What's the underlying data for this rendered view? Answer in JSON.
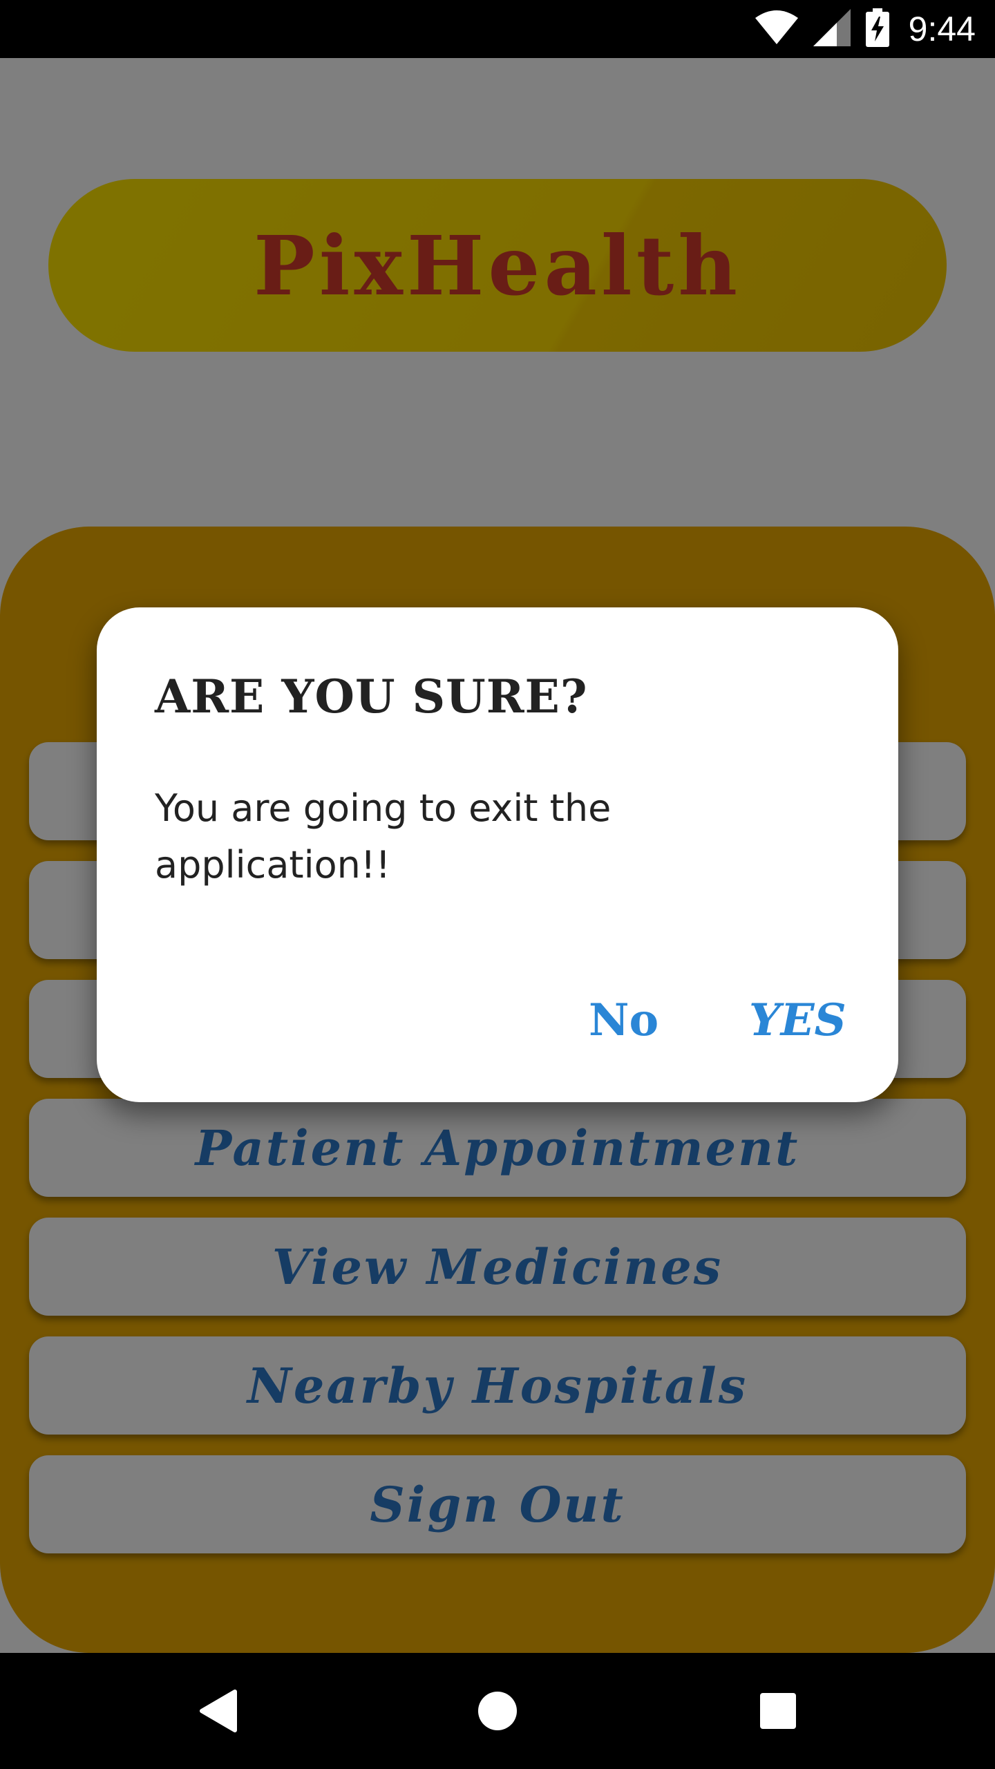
{
  "status_bar": {
    "time": "9:44",
    "icons": [
      "wifi-icon",
      "cell-signal-icon",
      "battery-charging-icon"
    ]
  },
  "app": {
    "title": "PixHealth",
    "menu_items": [
      "",
      "",
      "",
      "Patient Appointment",
      "View Medicines",
      "Nearby Hospitals",
      "Sign Out"
    ],
    "colors": {
      "title_bg": "#ffe600",
      "title_text": "#d33a2c",
      "panel_bg": "#ecab00",
      "menu_text": "#2c78c8"
    }
  },
  "dialog": {
    "title": "ARE YOU SURE?",
    "message": "You are going to exit the application!!",
    "no_label": "No",
    "yes_label": "YES",
    "button_color": "#2a86d6"
  },
  "nav_bar": {
    "icons": [
      "back-icon",
      "home-icon",
      "recents-icon"
    ]
  }
}
